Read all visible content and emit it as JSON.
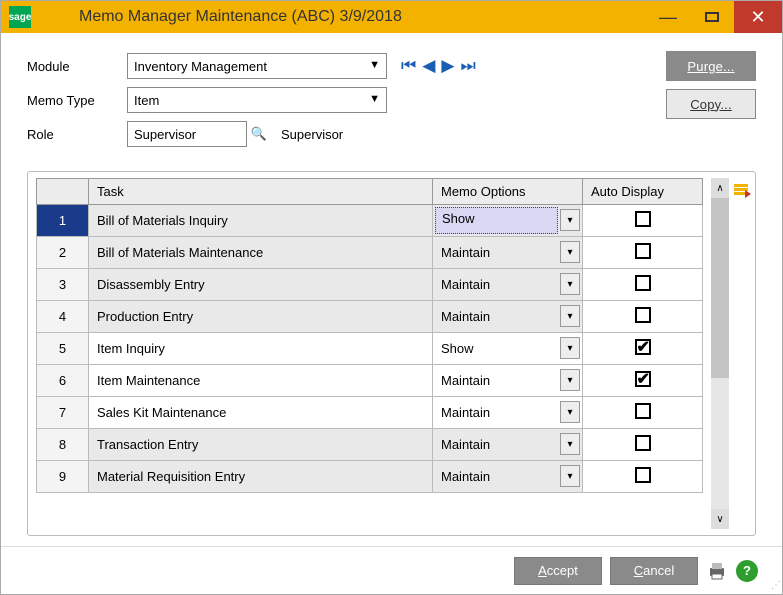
{
  "title": "Memo Manager Maintenance (ABC) 3/9/2018",
  "form": {
    "module_label": "Module",
    "module_value": "Inventory Management",
    "memotype_label": "Memo Type",
    "memotype_value": "Item",
    "role_label": "Role",
    "role_value": "Supervisor",
    "role_display": "Supervisor"
  },
  "buttons": {
    "purge": "Purge...",
    "copy": "Copy...",
    "accept": "Accept",
    "cancel": "Cancel"
  },
  "columns": {
    "task": "Task",
    "memo": "Memo Options",
    "auto": "Auto Display"
  },
  "rows": [
    {
      "n": "1",
      "task": "Bill of Materials Inquiry",
      "memo": "Show",
      "auto": false,
      "shade": true,
      "sel": true
    },
    {
      "n": "2",
      "task": "Bill of Materials Maintenance",
      "memo": "Maintain",
      "auto": false,
      "shade": true
    },
    {
      "n": "3",
      "task": "Disassembly Entry",
      "memo": "Maintain",
      "auto": false,
      "shade": true
    },
    {
      "n": "4",
      "task": "Production Entry",
      "memo": "Maintain",
      "auto": false,
      "shade": true
    },
    {
      "n": "5",
      "task": "Item Inquiry",
      "memo": "Show",
      "auto": true,
      "shade": false
    },
    {
      "n": "6",
      "task": "Item Maintenance",
      "memo": "Maintain",
      "auto": true,
      "shade": false
    },
    {
      "n": "7",
      "task": "Sales Kit Maintenance",
      "memo": "Maintain",
      "auto": false,
      "shade": false
    },
    {
      "n": "8",
      "task": "Transaction Entry",
      "memo": "Maintain",
      "auto": false,
      "shade": true
    },
    {
      "n": "9",
      "task": "Material Requisition Entry",
      "memo": "Maintain",
      "auto": false,
      "shade": true
    }
  ]
}
